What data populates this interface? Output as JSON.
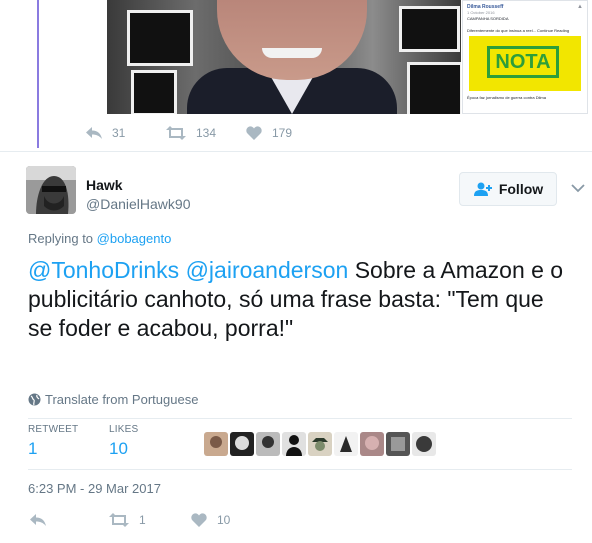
{
  "prev_tweet": {
    "actions": {
      "reply_count": "31",
      "retweet_count": "134",
      "like_count": "179"
    },
    "fb_card": {
      "author": "Dilma Rousseff",
      "date": "1 October 2016",
      "title": "CAMPANHA SORDIDA",
      "desc": "Diferentemente do que insinua a reel... Continue Reading",
      "banner": "NOTA",
      "caption": "Época faz jornalismo de guerra contra Dilma"
    }
  },
  "tweet": {
    "author_name": "Hawk",
    "author_handle": "@DanielHawk90",
    "follow_label": "Follow",
    "replying_prefix": "Replying to",
    "replying_to": "@bobagento",
    "mention1": "@TonhoDrinks",
    "mention2": "@jairoanderson",
    "body": "Sobre a Amazon e o publicitário canhoto, só uma frase basta: \"Tem que se foder e acabou, porra!\"",
    "translate_label": "Translate from Portuguese",
    "stats": {
      "retweets_label": "RETWEET",
      "retweets_value": "1",
      "likes_label": "LIKES",
      "likes_value": "10"
    },
    "timestamp": "6:23 PM - 29 Mar 2017",
    "actions": {
      "retweet_count": "1",
      "like_count": "10"
    }
  },
  "colors": {
    "link": "#1da1f2",
    "thread_line": "#8a7be0",
    "muted": "#657786"
  },
  "icons": [
    "reply-icon",
    "retweet-icon",
    "heart-icon",
    "follow-person-icon",
    "chevron-down-icon",
    "globe-icon"
  ]
}
